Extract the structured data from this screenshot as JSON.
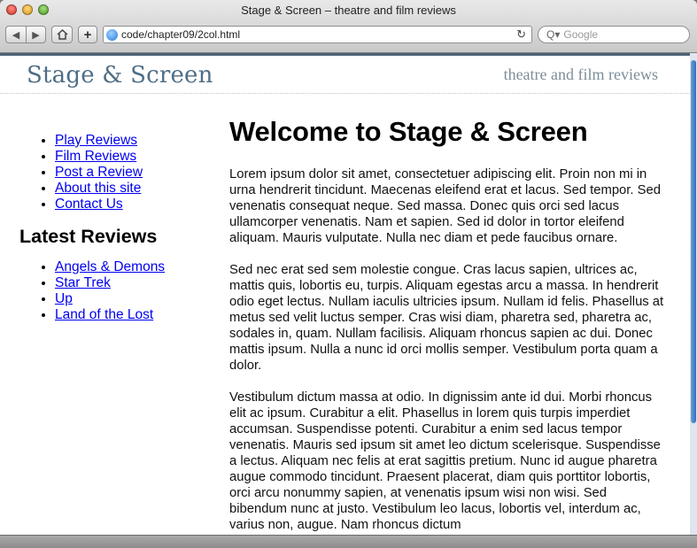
{
  "window": {
    "title": "Stage & Screen – theatre and film reviews",
    "address": "code/chapter09/2col.html",
    "search_placeholder": "Google"
  },
  "site": {
    "title": "Stage & Screen",
    "tagline": "theatre and film reviews"
  },
  "nav": {
    "items": [
      "Play Reviews",
      "Film Reviews",
      "Post a Review",
      "About this site",
      "Contact Us"
    ]
  },
  "latest": {
    "heading": "Latest Reviews",
    "items": [
      "Angels & Demons",
      "Star Trek",
      "Up",
      "Land of the Lost"
    ]
  },
  "main": {
    "heading": "Welcome to Stage & Screen",
    "paragraphs": [
      "Lorem ipsum dolor sit amet, consectetuer adipiscing elit. Proin non mi in urna hendrerit tincidunt. Maecenas eleifend erat et lacus. Sed tempor. Sed venenatis consequat neque. Sed massa. Donec quis orci sed lacus ullamcorper venenatis. Nam et sapien. Sed id dolor in tortor eleifend aliquam. Mauris vulputate. Nulla nec diam et pede faucibus ornare.",
      "Sed nec erat sed sem molestie congue. Cras lacus sapien, ultrices ac, mattis quis, lobortis eu, turpis. Aliquam egestas arcu a massa. In hendrerit odio eget lectus. Nullam iaculis ultricies ipsum. Nullam id felis. Phasellus at metus sed velit luctus semper. Cras wisi diam, pharetra sed, pharetra ac, sodales in, quam. Nullam facilisis. Aliquam rhoncus sapien ac dui. Donec mattis ipsum. Nulla a nunc id orci mollis semper. Vestibulum porta quam a dolor.",
      "Vestibulum dictum massa at odio. In dignissim ante id dui. Morbi rhoncus elit ac ipsum. Curabitur a elit. Phasellus in lorem quis turpis imperdiet accumsan. Suspendisse potenti. Curabitur a enim sed lacus tempor venenatis. Mauris sed ipsum sit amet leo dictum scelerisque. Suspendisse a lectus. Aliquam nec felis at erat sagittis pretium. Nunc id augue pharetra augue commodo tincidunt. Praesent placerat, diam quis porttitor lobortis, orci arcu nonummy sapien, at venenatis ipsum wisi non wisi. Sed bibendum nunc at justo. Vestibulum leo lacus, lobortis vel, interdum ac, varius non, augue. Nam rhoncus dictum"
    ]
  }
}
